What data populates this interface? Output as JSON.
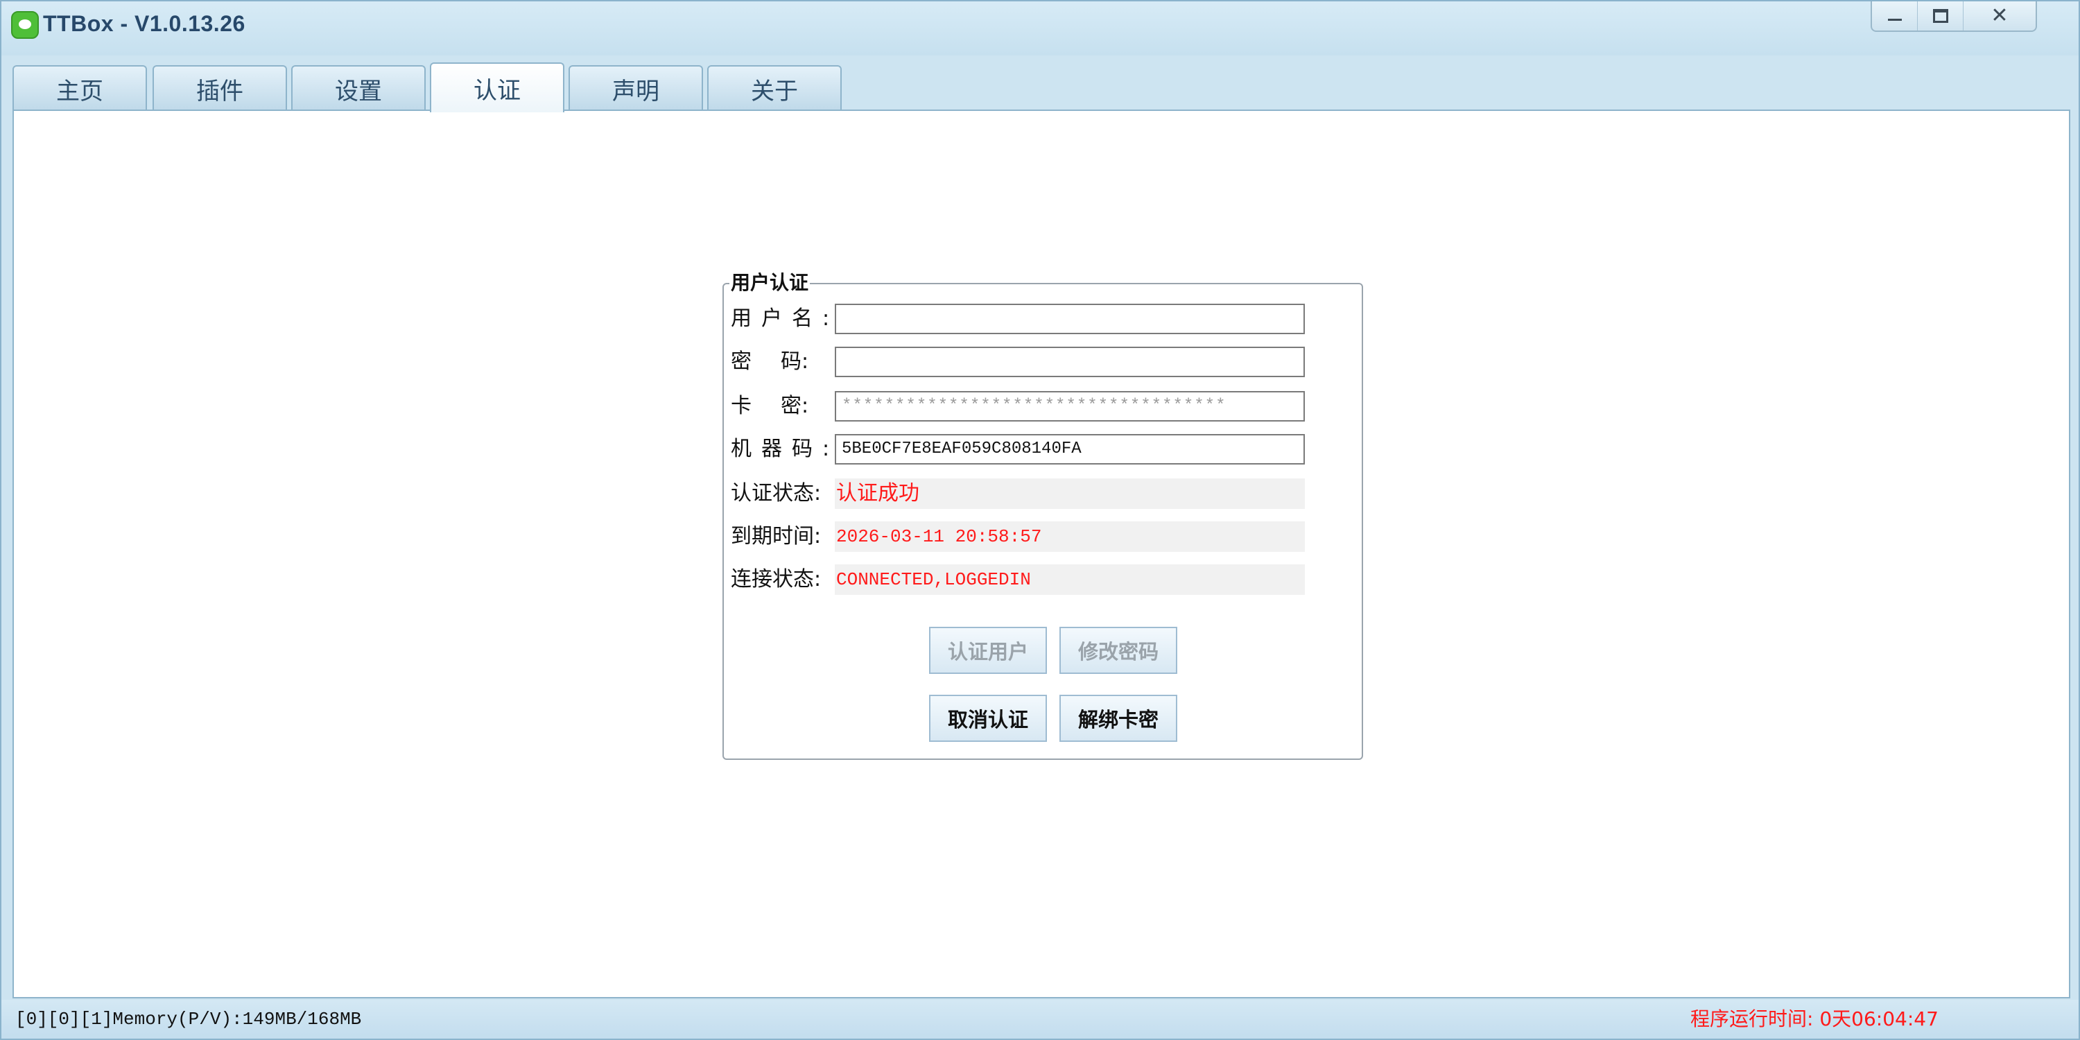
{
  "window": {
    "title": "TTBox - V1.0.13.26",
    "controls": {
      "minimize": "minimize-icon",
      "maximize": "maximize-icon",
      "close_glyph": "✕"
    }
  },
  "tabs": [
    {
      "label": "主页"
    },
    {
      "label": "插件"
    },
    {
      "label": "设置"
    },
    {
      "label": "认证",
      "active": true
    },
    {
      "label": "声明"
    },
    {
      "label": "关于"
    }
  ],
  "auth": {
    "group_title": "用户认证",
    "username_label": "用户名:",
    "username_value": "",
    "password_label_a": "密",
    "password_label_b": "码:",
    "password_value": "",
    "card_label_a": "卡",
    "card_label_b": "密:",
    "card_value": "************************************",
    "machine_label": "机器码:",
    "machine_value": "5BE0CF7E8EAF059C808140FA",
    "status_label": "认证状态:",
    "status_value": "认证成功",
    "expire_label": "到期时间:",
    "expire_value": "2026-03-11 20:58:57",
    "conn_label": "连接状态:",
    "conn_value": "CONNECTED,LOGGEDIN",
    "buttons": {
      "auth_user": "认证用户",
      "change_password": "修改密码",
      "cancel_auth": "取消认证",
      "unbind_card": "解绑卡密"
    }
  },
  "status_bar": {
    "memory": "[0][0][1]Memory(P/V):149MB/168MB",
    "runtime": "程序运行时间: 0天06:04:47"
  },
  "colors": {
    "accent_red": "#ff1a1a",
    "tab_text": "#2d4e6b",
    "chrome_bg": "#cde4f1"
  }
}
